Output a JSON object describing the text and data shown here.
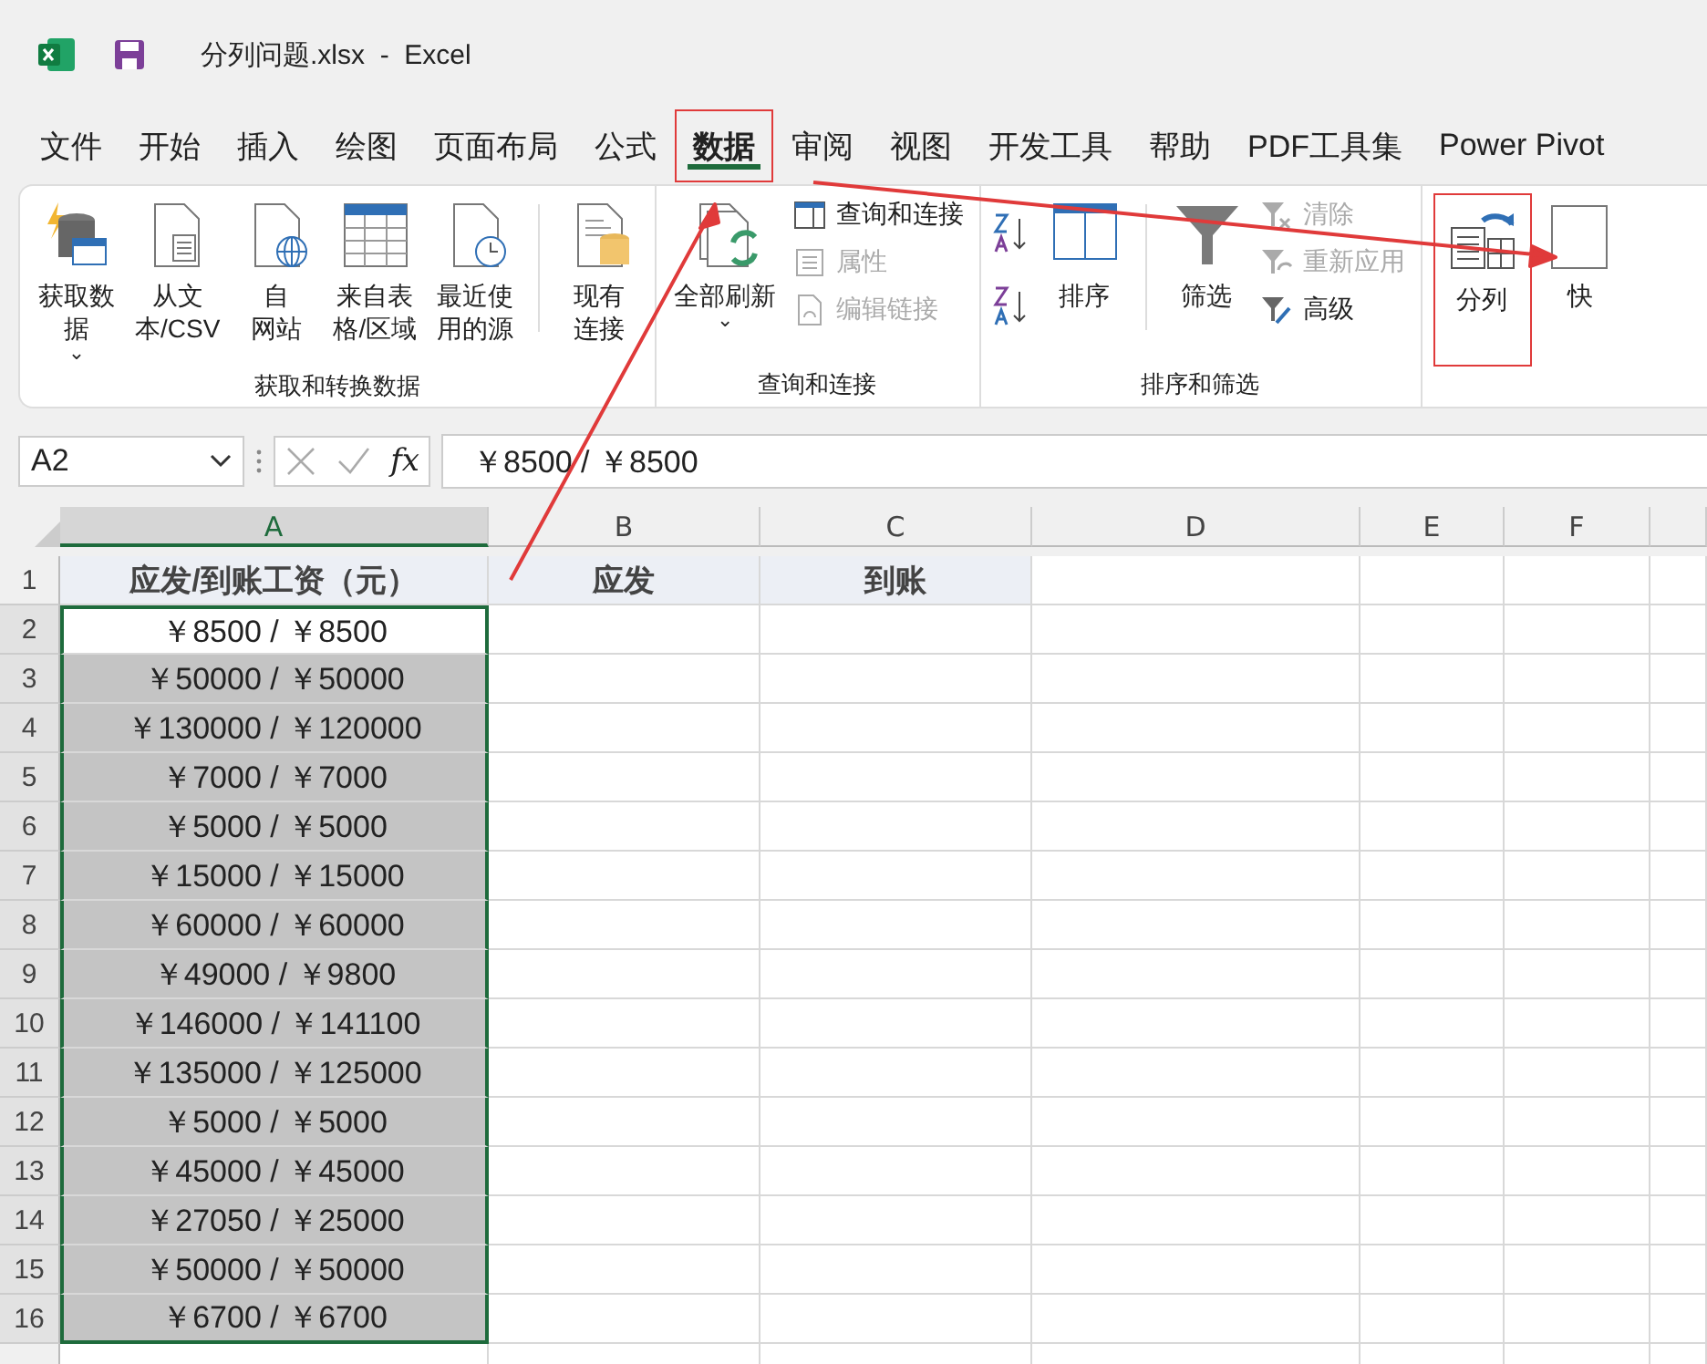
{
  "window": {
    "title": "分列问题.xlsx  -  Excel"
  },
  "tabs": [
    {
      "label": "文件",
      "selected": false,
      "highlighted": false
    },
    {
      "label": "开始",
      "selected": false,
      "highlighted": false
    },
    {
      "label": "插入",
      "selected": false,
      "highlighted": false
    },
    {
      "label": "绘图",
      "selected": false,
      "highlighted": false
    },
    {
      "label": "页面布局",
      "selected": false,
      "highlighted": false
    },
    {
      "label": "公式",
      "selected": false,
      "highlighted": false
    },
    {
      "label": "数据",
      "selected": true,
      "highlighted": true
    },
    {
      "label": "审阅",
      "selected": false,
      "highlighted": false
    },
    {
      "label": "视图",
      "selected": false,
      "highlighted": false
    },
    {
      "label": "开发工具",
      "selected": false,
      "highlighted": false
    },
    {
      "label": "帮助",
      "selected": false,
      "highlighted": false
    },
    {
      "label": "PDF工具集",
      "selected": false,
      "highlighted": false
    },
    {
      "label": "Power Pivot",
      "selected": false,
      "highlighted": false
    }
  ],
  "ribbon": {
    "groups": [
      {
        "label": "获取和转换数据",
        "items": [
          {
            "kind": "large",
            "lines": [
              "获取数",
              "据"
            ],
            "caret": "⌄",
            "highlighted": false
          },
          {
            "kind": "large",
            "lines": [
              "从文",
              "本/CSV"
            ],
            "highlighted": false
          },
          {
            "kind": "large",
            "lines": [
              "自",
              "网站"
            ],
            "highlighted": false
          },
          {
            "kind": "large",
            "lines": [
              "来自表",
              "格/区域"
            ],
            "highlighted": false
          },
          {
            "kind": "large",
            "lines": [
              "最近使",
              "用的源"
            ],
            "highlighted": false
          },
          {
            "kind": "separator"
          },
          {
            "kind": "large",
            "lines": [
              "现有",
              "连接"
            ],
            "highlighted": false
          }
        ]
      },
      {
        "label": "查询和连接",
        "items": [
          {
            "kind": "large",
            "lines": [
              "全部刷新"
            ],
            "caret": "⌄",
            "highlighted": false
          },
          {
            "kind": "stack",
            "children": [
              {
                "label": "查询和连接",
                "disabled": false
              },
              {
                "label": "属性",
                "disabled": true
              },
              {
                "label": "编辑链接",
                "disabled": true
              }
            ]
          }
        ]
      },
      {
        "label": "排序和筛选",
        "items": [
          {
            "kind": "sortpair"
          },
          {
            "kind": "large",
            "lines": [
              "排序"
            ],
            "highlighted": false
          },
          {
            "kind": "separator"
          },
          {
            "kind": "large",
            "lines": [
              "筛选"
            ],
            "highlighted": false
          },
          {
            "kind": "stack",
            "children": [
              {
                "label": "清除",
                "disabled": true
              },
              {
                "label": "重新应用",
                "disabled": true
              },
              {
                "label": "高级",
                "disabled": false
              }
            ]
          }
        ]
      },
      {
        "items": [
          {
            "kind": "large",
            "lines": [
              "分列"
            ],
            "highlighted": true
          },
          {
            "kind": "large",
            "lines": [
              "快"
            ],
            "highlighted": false
          }
        ]
      }
    ]
  },
  "formula_bar": {
    "name_box": "A2",
    "fx_label": "fx",
    "value": "￥8500 / ￥8500"
  },
  "columns": [
    {
      "label": "A",
      "selected": true
    },
    {
      "label": "B",
      "selected": false
    },
    {
      "label": "C",
      "selected": false
    },
    {
      "label": "D",
      "selected": false
    },
    {
      "label": "E",
      "selected": false
    },
    {
      "label": "F",
      "selected": false
    }
  ],
  "rows": [
    {
      "number": "1",
      "cells": [
        "应发/到账工资（元）",
        "应发",
        "到账"
      ],
      "header": true
    },
    {
      "number": "2",
      "cells": [
        "￥8500 / ￥8500"
      ],
      "header": false,
      "selected": true,
      "active": true
    },
    {
      "number": "3",
      "cells": [
        "￥50000 / ￥50000"
      ],
      "header": false,
      "selected": true,
      "active": false
    },
    {
      "number": "4",
      "cells": [
        "￥130000 / ￥120000"
      ],
      "header": false,
      "selected": true,
      "active": false
    },
    {
      "number": "5",
      "cells": [
        "￥7000 / ￥7000"
      ],
      "header": false,
      "selected": true,
      "active": false
    },
    {
      "number": "6",
      "cells": [
        "￥5000 / ￥5000"
      ],
      "header": false,
      "selected": true,
      "active": false
    },
    {
      "number": "7",
      "cells": [
        "￥15000 / ￥15000"
      ],
      "header": false,
      "selected": true,
      "active": false
    },
    {
      "number": "8",
      "cells": [
        "￥60000 / ￥60000"
      ],
      "header": false,
      "selected": true,
      "active": false
    },
    {
      "number": "9",
      "cells": [
        "￥49000 / ￥9800"
      ],
      "header": false,
      "selected": true,
      "active": false
    },
    {
      "number": "10",
      "cells": [
        "￥146000 / ￥141100"
      ],
      "header": false,
      "selected": true,
      "active": false
    },
    {
      "number": "11",
      "cells": [
        "￥135000 / ￥125000"
      ],
      "header": false,
      "selected": true,
      "active": false
    },
    {
      "number": "12",
      "cells": [
        "￥5000 / ￥5000"
      ],
      "header": false,
      "selected": true,
      "active": false
    },
    {
      "number": "13",
      "cells": [
        "￥45000 / ￥45000"
      ],
      "header": false,
      "selected": true,
      "active": false
    },
    {
      "number": "14",
      "cells": [
        "￥27050 / ￥25000"
      ],
      "header": false,
      "selected": true,
      "active": false
    },
    {
      "number": "15",
      "cells": [
        "￥50000 / ￥50000"
      ],
      "header": false,
      "selected": true,
      "active": false
    },
    {
      "number": "16",
      "cells": [
        "￥6700 / ￥6700"
      ],
      "header": false,
      "selected": true,
      "active": false
    },
    {
      "cells": []
    }
  ]
}
